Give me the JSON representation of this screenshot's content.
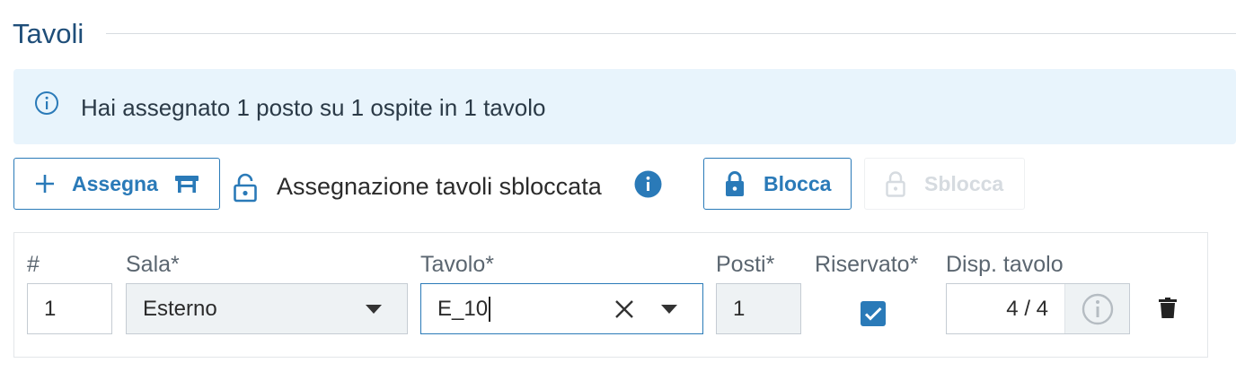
{
  "section": {
    "title": "Tavoli"
  },
  "info": {
    "message": "Hai assegnato 1 posto su 1 ospite in 1 tavolo"
  },
  "toolbar": {
    "assign_label": "Assegna",
    "lock_status": "Assegnazione tavoli sbloccata",
    "lock_label": "Blocca",
    "unlock_label": "Sblocca"
  },
  "table": {
    "headers": {
      "index": "#",
      "room": "Sala*",
      "table": "Tavolo*",
      "seats": "Posti*",
      "reserved": "Riservato*",
      "availability": "Disp. tavolo"
    },
    "row": {
      "index": "1",
      "room": "Esterno",
      "table": "E_10",
      "seats": "1",
      "reserved": true,
      "availability": "4 / 4"
    }
  },
  "colors": {
    "accent": "#2a7ab8",
    "banner_bg": "#e8f4fc",
    "title": "#1f4e79",
    "checkbox": "#2a7ab8"
  },
  "icons": [
    "info-icon",
    "plus-icon",
    "table-icon",
    "unlocked-icon",
    "info-filled-icon",
    "lock-icon",
    "lock-disabled-icon",
    "dropdown-arrow-icon",
    "clear-icon",
    "checkbox-checked-icon",
    "info-outline-icon",
    "trash-icon"
  ]
}
